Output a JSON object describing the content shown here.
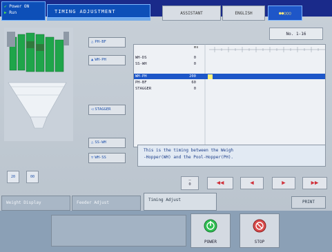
{
  "header": {
    "status_line1": "Power ON",
    "status_line2": "Run",
    "title": "TIMING ADJUSTMENT",
    "assistant_label": "ASSISTANT",
    "language_label": "ENGLISH",
    "indicator": "●●○○○"
  },
  "side_buttons": [
    {
      "label": "PH-BF",
      "arrow": "△"
    },
    {
      "label": "WH-PH",
      "arrow": "▲"
    },
    {
      "label": "STAGGER",
      "arrow": "◁"
    },
    {
      "label": "SS-WH",
      "arrow": "△"
    },
    {
      "label": "WH-SS",
      "arrow": "▽"
    }
  ],
  "panel": {
    "no_range": "No. 1-16",
    "unit": "ms",
    "rows": [
      {
        "label": "WH-DS",
        "value": "0"
      },
      {
        "label": "SS-WH",
        "value": "0"
      },
      {
        "label": "WH-PH",
        "value": "200",
        "selected": true
      },
      {
        "label": "PH-BF",
        "value": "60"
      },
      {
        "label": "STAGGER",
        "value": "0"
      }
    ],
    "hint_line1": "This is the timing between the Weigh",
    "hint_line2": "-Hopper(WH) and the Pool-Hopper(PH)."
  },
  "nav": {
    "zero_label": "0",
    "buttons": [
      "◀◀",
      "◀",
      "▶",
      "▶▶"
    ]
  },
  "small_icons": [
    "20",
    "00"
  ],
  "tabs": [
    {
      "label": "Weight Display",
      "active": false
    },
    {
      "label": "Feeder Adjust",
      "active": false
    },
    {
      "label": "Timing Adjust",
      "active": true
    }
  ],
  "print_label": "PRINT",
  "power_label": "POWER",
  "stop_label": "STOP",
  "colors": {
    "brand_blue": "#1a2a8a",
    "selection": "#1d56c8",
    "highlight_yellow": "#fff27a",
    "power_green": "#2fbf52",
    "stop_red": "#d94a4a"
  }
}
